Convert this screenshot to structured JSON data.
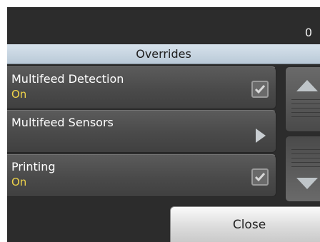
{
  "header": {
    "counter": "0",
    "title": "Overrides"
  },
  "options": [
    {
      "label": "Multifeed Detection",
      "value": "On",
      "control": "checkbox",
      "checked": true
    },
    {
      "label": "Multifeed Sensors",
      "value": "",
      "control": "submenu-arrow"
    },
    {
      "label": "Printing",
      "value": "On",
      "control": "checkbox",
      "checked": true
    }
  ],
  "scroll": {
    "up_icon": "triangle-up-icon",
    "down_icon": "triangle-down-icon"
  },
  "footer": {
    "close_label": "Close"
  },
  "colors": {
    "value_text": "#f0d44a",
    "title_bar": "#c8d6e2",
    "background": "#2c2c2c"
  }
}
